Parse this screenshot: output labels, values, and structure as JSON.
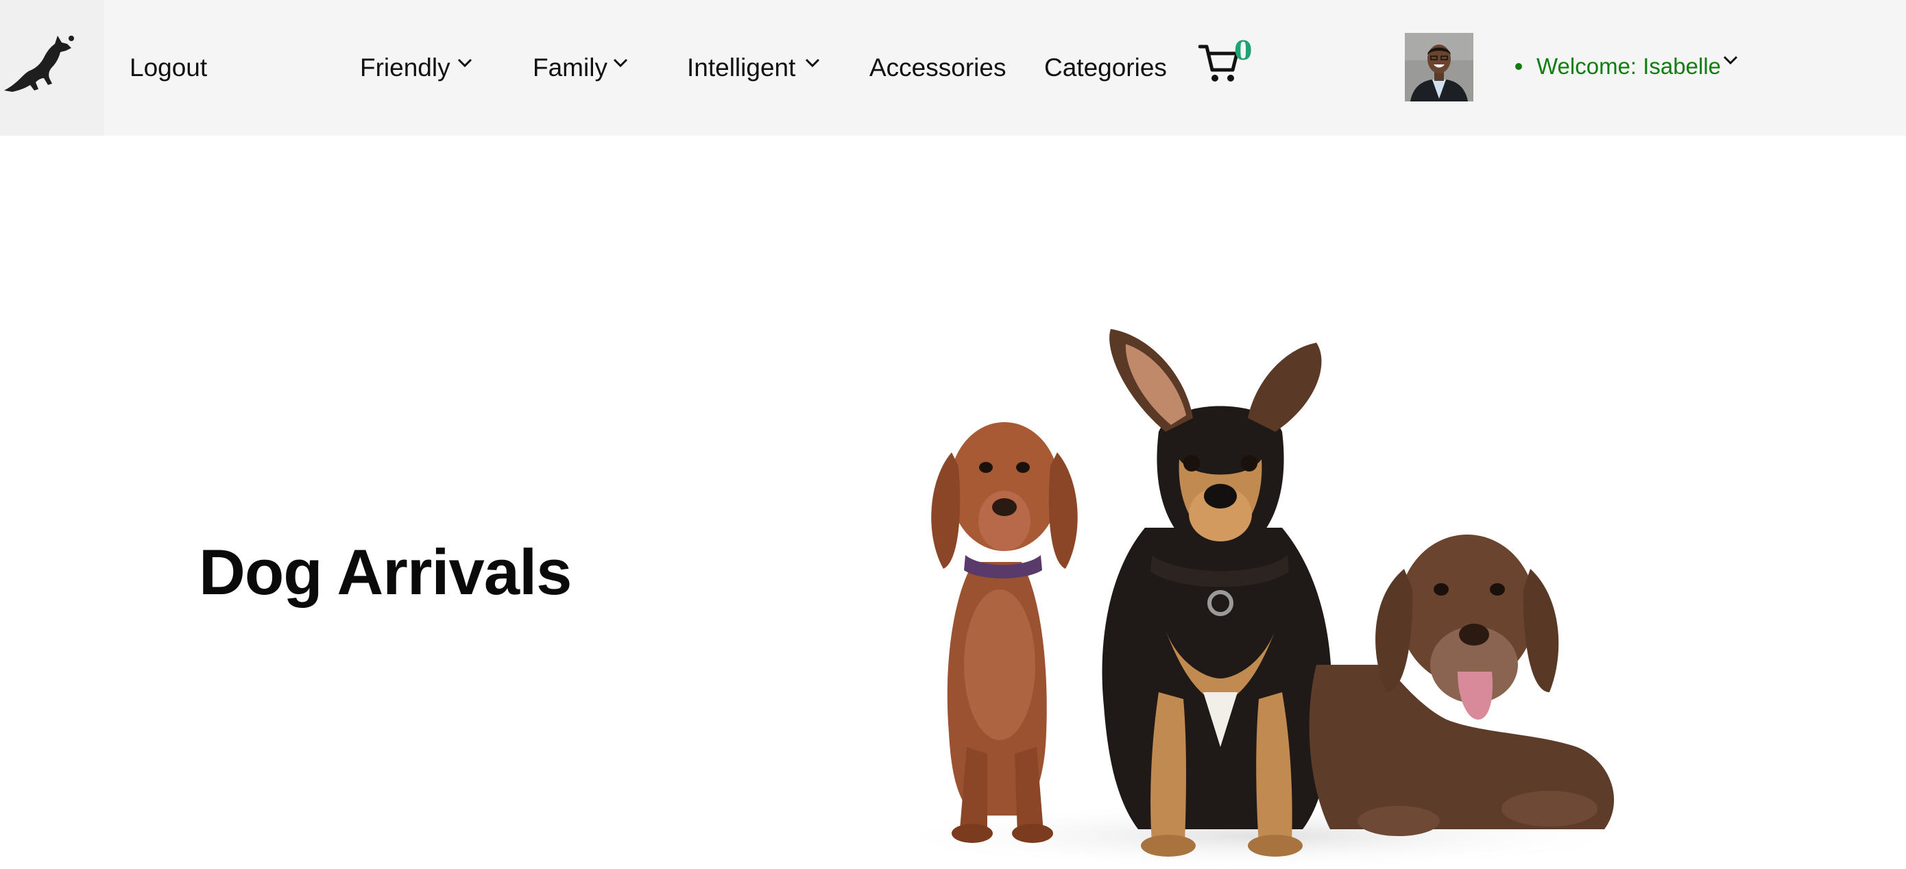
{
  "nav": {
    "logo_icon": "jumping-dog-logo-icon",
    "logout": "Logout",
    "items": [
      {
        "label": "Friendly",
        "dropdown": true
      },
      {
        "label": "Family",
        "dropdown": true
      },
      {
        "label": "Intelligent",
        "dropdown": true
      },
      {
        "label": "Accessories",
        "dropdown": false
      },
      {
        "label": "Categories",
        "dropdown": false
      }
    ],
    "cart": {
      "icon": "cart-icon",
      "count": "0",
      "count_color": "#1fa372"
    },
    "user": {
      "avatar_icon": "user-avatar",
      "welcome": "Welcome: Isabelle",
      "welcome_color": "#0f7d0f"
    }
  },
  "hero": {
    "title": "Dog Arrivals",
    "image_icon": "three-dogs-photo"
  },
  "colors": {
    "navbar_bg": "#f5f5f5",
    "text": "#111111",
    "accent_green": "#0f7d0f"
  }
}
